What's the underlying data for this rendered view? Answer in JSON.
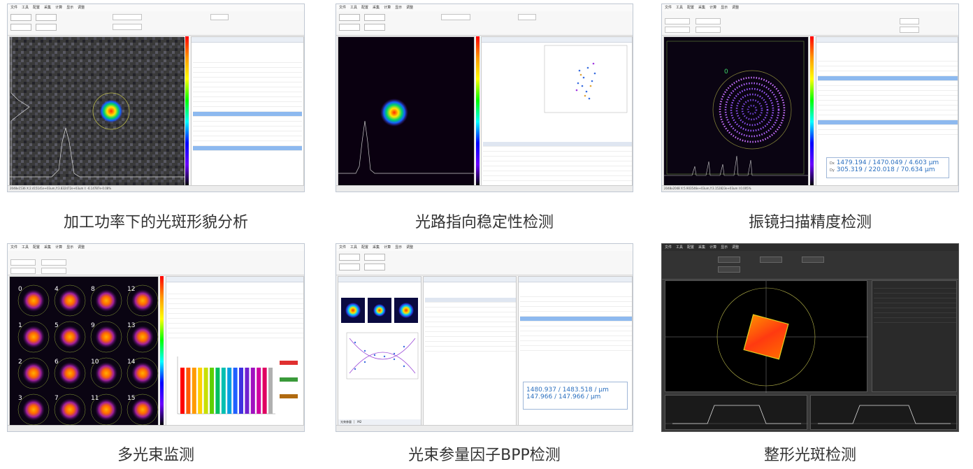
{
  "captions": [
    "加工功率下的光斑形貌分析",
    "光路指向稳定性检测",
    "振镜扫描精度检测",
    "多光束监测",
    "光束参量因子BPP检测",
    "整形光斑检测"
  ],
  "tile1": {
    "status": "2048x1536    X:2.415141e+03um,Y:3.832472e+03um I: -6.14787e-0.08%"
  },
  "tile3": {
    "readout_line1": "1479.194 / 1470.049 / 4.603 μm",
    "readout_line2": "305.319 / 220.018 / 70.634 μm",
    "readout_prefix1": "Dx",
    "readout_prefix2": "Dy",
    "status": "2048x2048   X:5.903546e+03um,Y:3.152823e+03um I:0.005%",
    "spot_label": "0"
  },
  "tile4": {
    "grid_labels": [
      "0",
      "4",
      "8",
      "12",
      "1",
      "5",
      "9",
      "13",
      "2",
      "6",
      "10",
      "14",
      "3",
      "7",
      "11",
      "15"
    ]
  },
  "tile5": {
    "readout_line1": "1480.937 / 1483.518 / μm",
    "readout_line2": "147.966 / 147.966 / μm",
    "tabs": [
      "光束参量",
      "M2"
    ]
  },
  "colors": {
    "accent_blue": "#2a6fbf",
    "selection": "#8db9ef",
    "caption_text": "#333333"
  }
}
